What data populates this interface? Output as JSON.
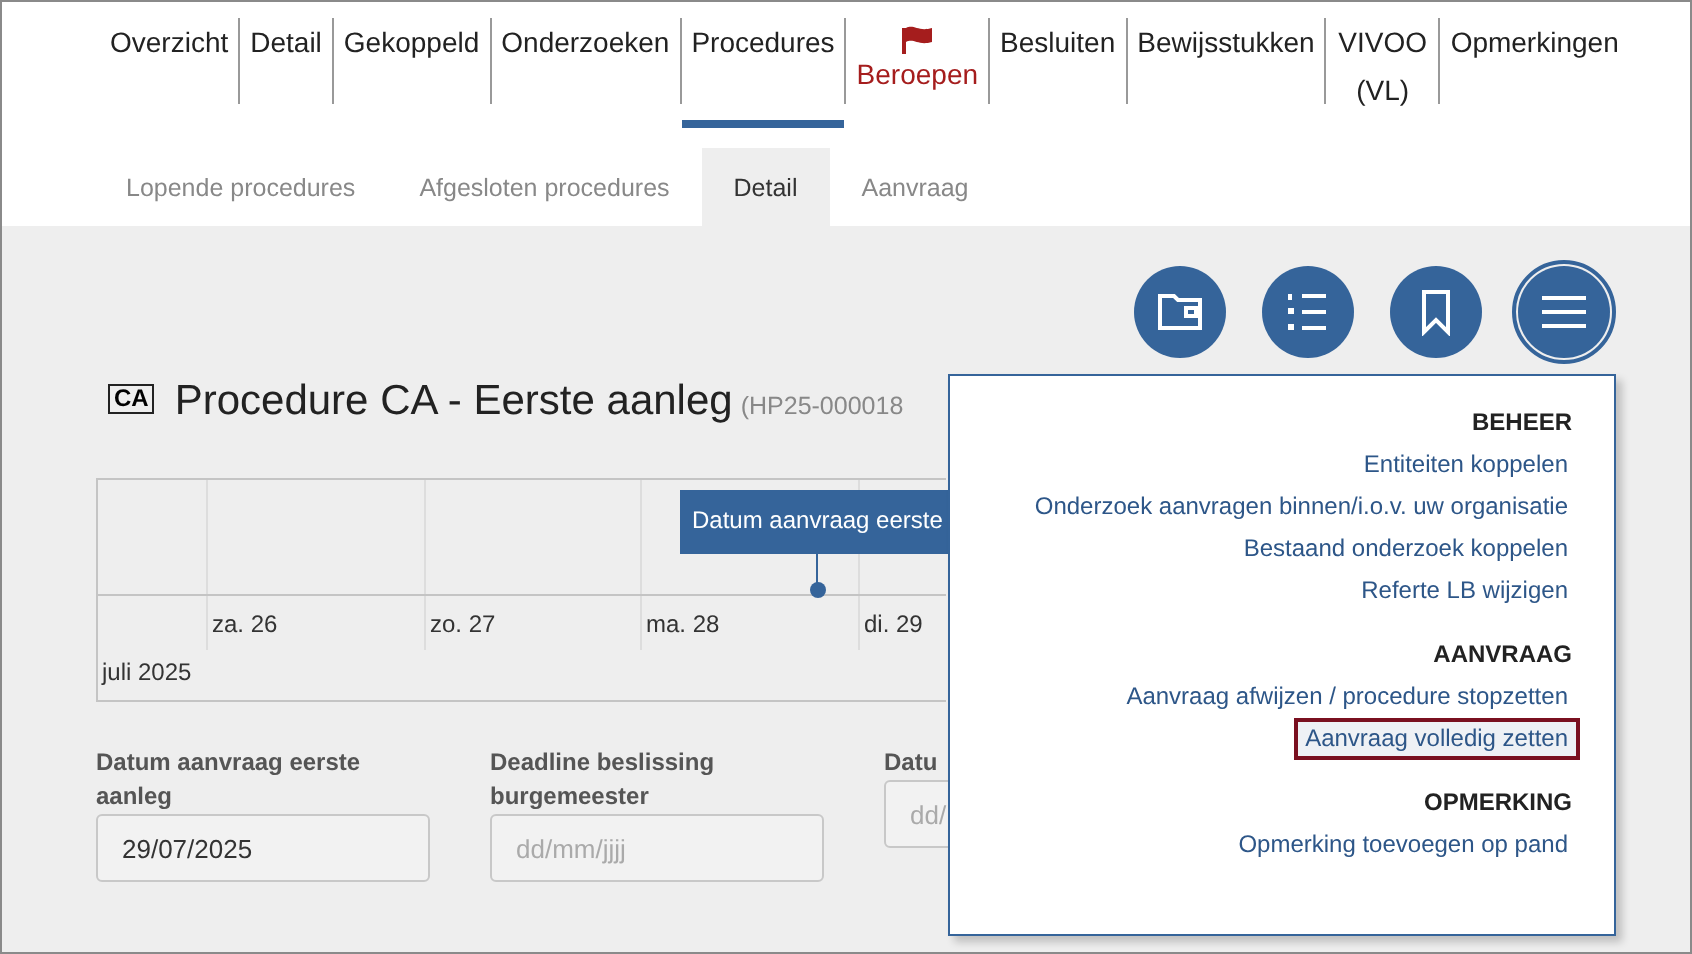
{
  "nav": [
    {
      "label": "Overzicht",
      "kind": "plain",
      "selected": false
    },
    {
      "label": "Detail",
      "kind": "plain",
      "selected": false
    },
    {
      "label": "Gekoppeld",
      "kind": "plain",
      "selected": false
    },
    {
      "label": "Onderzoeken",
      "kind": "plain",
      "selected": false
    },
    {
      "label": "Procedures",
      "kind": "plain",
      "selected": true
    },
    {
      "label": "Beroepen",
      "kind": "flagged",
      "selected": false
    },
    {
      "label": "Besluiten",
      "kind": "plain",
      "selected": false
    },
    {
      "label": "Bewijsstukken",
      "kind": "plain",
      "selected": false
    },
    {
      "label": "VIVOO (VL)",
      "kind": "plain",
      "selected": false
    },
    {
      "label": "Opmerkingen",
      "kind": "plain",
      "selected": false
    }
  ],
  "subtabs": [
    {
      "label": "Lopende procedures",
      "selected": false
    },
    {
      "label": "Afgesloten procedures",
      "selected": false
    },
    {
      "label": "Detail",
      "selected": true
    },
    {
      "label": "Aanvraag",
      "selected": false
    }
  ],
  "toolbar": [
    {
      "kind": "folder",
      "expanded": false
    },
    {
      "kind": "numbered-list",
      "expanded": false
    },
    {
      "kind": "bookmark",
      "expanded": false
    },
    {
      "kind": "menu",
      "expanded": true
    }
  ],
  "heading": {
    "badge": "CA",
    "title": "Procedure CA - Eerste aanleg",
    "code": "(HP25-000018"
  },
  "timeline": {
    "event": "Datum aanvraag eerste",
    "days": [
      "za. 26",
      "zo. 27",
      "ma. 28",
      "di. 29"
    ],
    "month": "juli 2025"
  },
  "fields": [
    {
      "label": "Datum aanvraag eerste aanleg",
      "value": "29/07/2025"
    },
    {
      "label": "Deadline beslissing burgemeester",
      "placeholder": "dd/mm/jjjj"
    },
    {
      "label": "Datu",
      "placeholder": "dd/"
    }
  ],
  "menu": [
    {
      "header": "BEHEER",
      "items": [
        {
          "label": "Entiteiten koppelen",
          "selected": false
        },
        {
          "label": "Onderzoek aanvragen binnen/i.o.v. uw organisatie",
          "selected": false
        },
        {
          "label": "Bestaand onderzoek koppelen",
          "selected": false
        },
        {
          "label": "Referte LB wijzigen",
          "selected": false
        }
      ]
    },
    {
      "header": "AANVRAAG",
      "items": [
        {
          "label": "Aanvraag afwijzen / procedure stopzetten",
          "selected": false
        },
        {
          "label": "Aanvraag volledig zetten",
          "selected": true
        }
      ]
    },
    {
      "header": "OPMERKING",
      "items": [
        {
          "label": "Opmerking toevoegen op pand",
          "selected": false
        }
      ]
    }
  ]
}
